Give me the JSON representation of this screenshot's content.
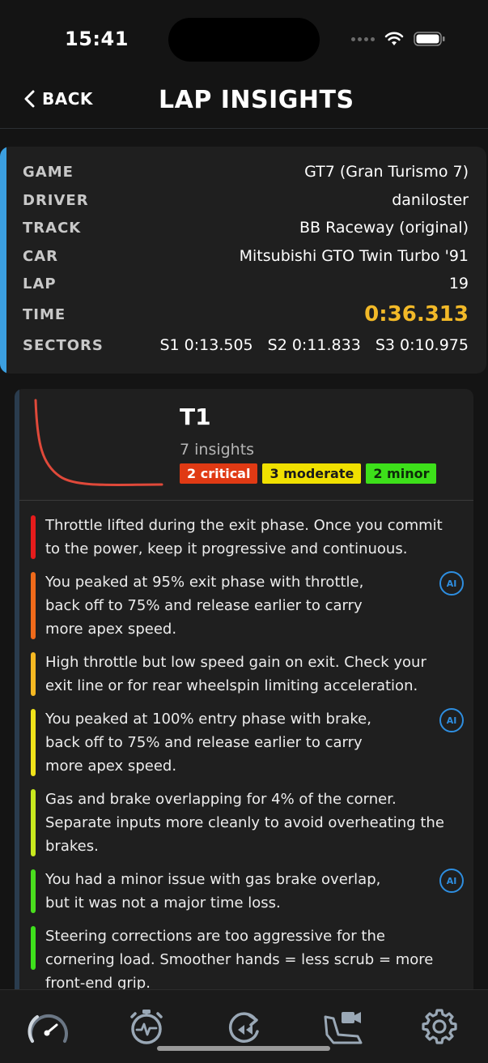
{
  "status_bar": {
    "time": "15:41"
  },
  "header": {
    "back_label": "BACK",
    "title": "LAP INSIGHTS"
  },
  "lap_info": {
    "rows": [
      {
        "label": "GAME",
        "value": "GT7 (Gran Turismo 7)"
      },
      {
        "label": "DRIVER",
        "value": "daniloster"
      },
      {
        "label": "TRACK",
        "value": "BB Raceway (original)"
      },
      {
        "label": "CAR",
        "value": "Mitsubishi GTO Twin Turbo '91"
      },
      {
        "label": "LAP",
        "value": "19"
      }
    ],
    "time_label": "TIME",
    "time_value": "0:36.313",
    "sectors_label": "SECTORS",
    "sectors": [
      "S1 0:13.505",
      "S2 0:11.833",
      "S3 0:10.975"
    ]
  },
  "corner": {
    "name": "T1",
    "insight_count": "7 insights",
    "badges": {
      "critical": "2 critical",
      "moderate": "3 moderate",
      "minor": "2 minor"
    },
    "ai_label": "AI",
    "insights": [
      {
        "severity_color": "#e61c1c",
        "text": "Throttle lifted during the exit phase. Once you commit to the power, keep it progressive and continuous.",
        "ai": false
      },
      {
        "severity_color": "#f06a1a",
        "text": "You peaked at 95% exit phase with throttle, back off to 75% and release earlier to carry more apex speed.",
        "ai": true
      },
      {
        "severity_color": "#f5b822",
        "text": "High throttle but low speed gain on exit. Check your exit line or for rear wheelspin limiting acceleration.",
        "ai": false
      },
      {
        "severity_color": "#f0e21a",
        "text": "You peaked at 100% entry phase with brake, back off to 75% and release earlier to carry more apex speed.",
        "ai": true
      },
      {
        "severity_color": "#c8e81e",
        "text": "Gas and brake overlapping for 4% of the corner. Separate inputs more cleanly to avoid overheating the brakes.",
        "ai": false
      },
      {
        "severity_color": "#4ade1e",
        "text": "You had a minor issue with gas brake overlap, but it was not a major time loss.",
        "ai": true
      },
      {
        "severity_color": "#3ee01c",
        "text": "Steering corrections are too aggressive for the cornering load. Smoother hands = less scrub = more front-end grip.",
        "ai": false
      }
    ]
  },
  "tabbar": {
    "items": [
      {
        "icon": "speedometer-icon",
        "active": true
      },
      {
        "icon": "stopwatch-pulse-icon",
        "active": false
      },
      {
        "icon": "replay-lap-icon",
        "active": false
      },
      {
        "icon": "seat-camera-icon",
        "active": false
      },
      {
        "icon": "gear-icon",
        "active": false
      }
    ]
  },
  "colors": {
    "accent_blue": "#3b9fe0",
    "time_gold": "#f2b928",
    "trace_red": "#e0493a",
    "ai_blue": "#2e8ee0"
  }
}
